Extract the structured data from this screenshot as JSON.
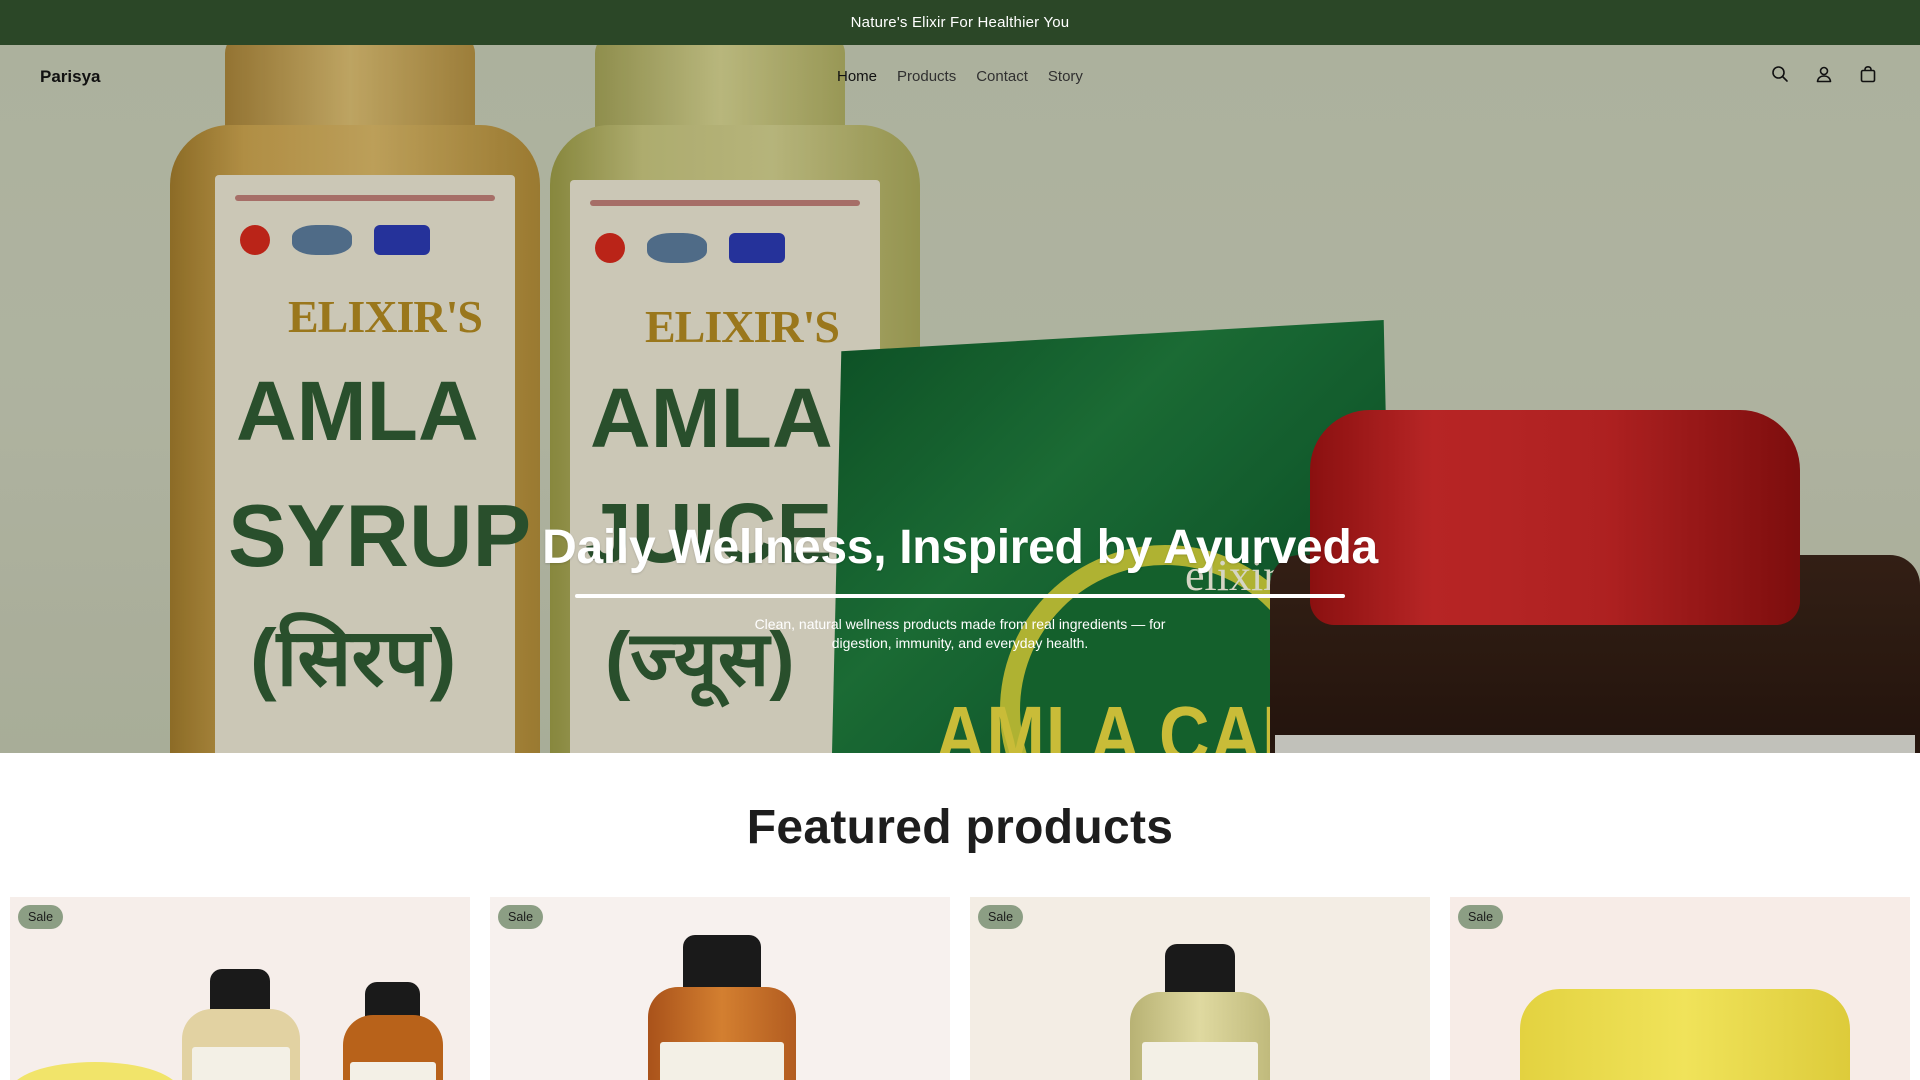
{
  "announcement": {
    "text": "Nature's Elixir For Healthier You"
  },
  "header": {
    "site_title": "Parisya",
    "nav": [
      {
        "label": "Home",
        "active": true
      },
      {
        "label": "Products",
        "active": false
      },
      {
        "label": "Contact",
        "active": false
      },
      {
        "label": "Story",
        "active": false
      }
    ],
    "icons": [
      "search-icon",
      "account-icon",
      "cart-icon"
    ]
  },
  "hero": {
    "title": "Daily Wellness, Inspired by Ayurveda",
    "subtitle": "Clean, natural wellness products made from real ingredients — for digestion, immunity, and everyday health.",
    "image_text": {
      "brand": "ELIXIR'S",
      "bottle1_line1": "AMLA",
      "bottle1_line2": "SYRUP",
      "bottle1_line3": "(सिरप)",
      "bottle2_line1": "AMLA",
      "bottle2_line2": "JUICE",
      "bottle2_line3": "(ज्यूस)",
      "pouch_text": "AMLA CAND",
      "pouch_brand": "elixir"
    }
  },
  "featured": {
    "title": "Featured products",
    "cards": [
      {
        "badge": "Sale"
      },
      {
        "badge": "Sale"
      },
      {
        "badge": "Sale"
      },
      {
        "badge": "Sale"
      }
    ]
  },
  "colors": {
    "announcement_bg": "#2b4727",
    "badge_bg": "#8c9e84"
  }
}
